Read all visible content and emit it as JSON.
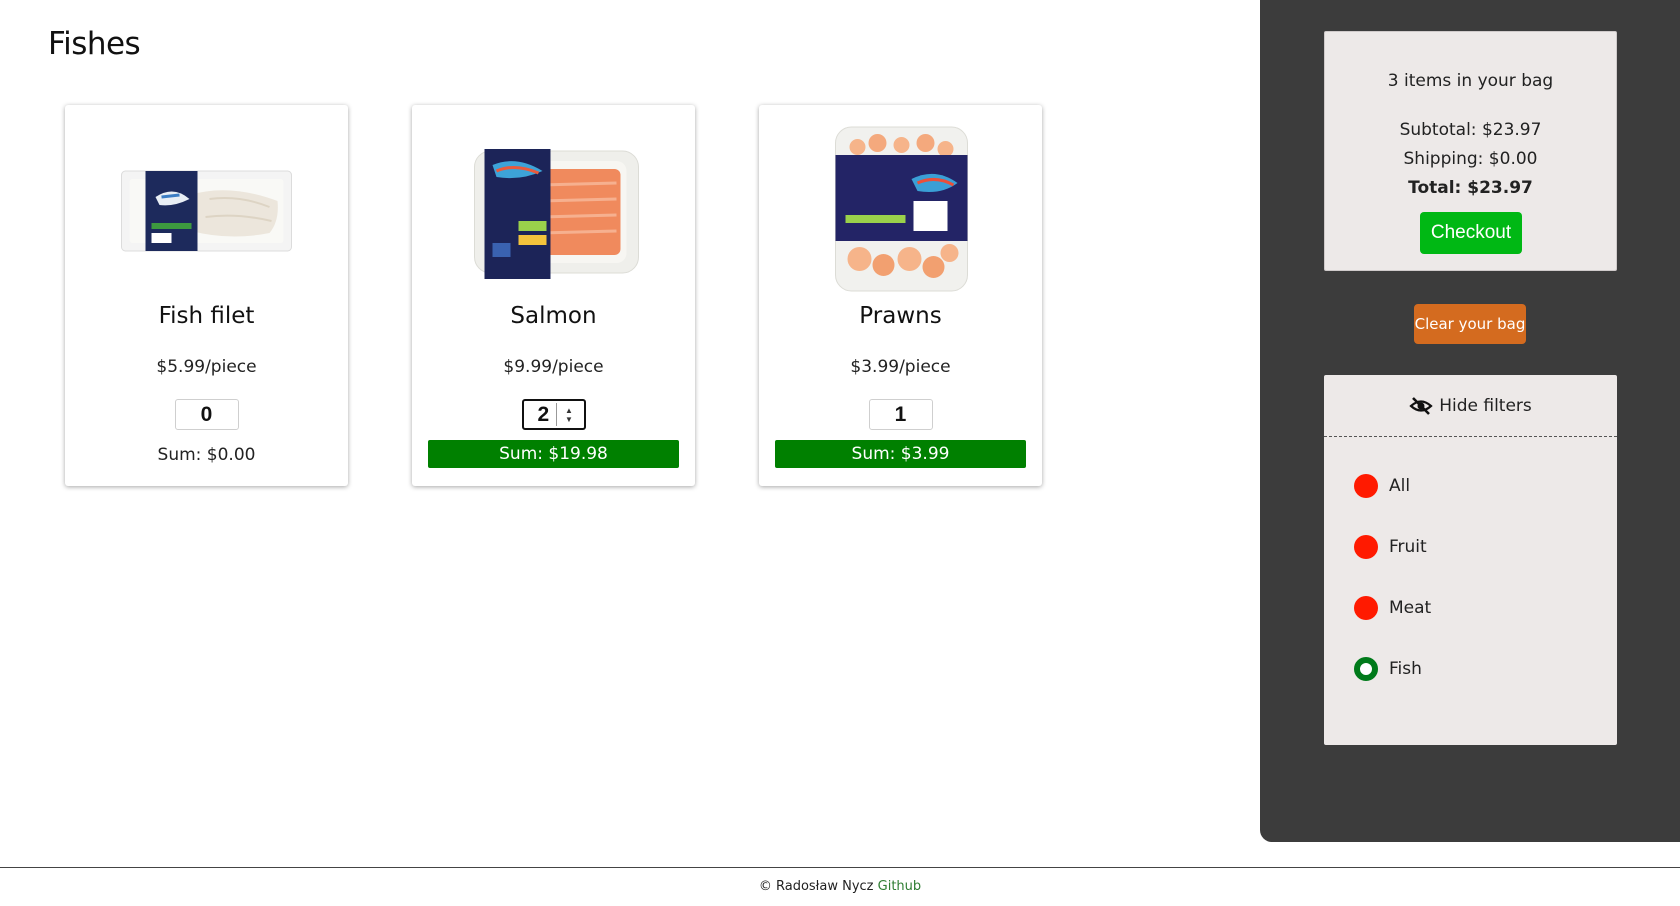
{
  "page": {
    "title": "Fishes"
  },
  "products": [
    {
      "name": "Fish filet",
      "price": "$5.99/piece",
      "quantity": "0",
      "sum": "Sum: $0.00",
      "image_icon": "fish-filet-package-icon"
    },
    {
      "name": "Salmon",
      "price": "$9.99/piece",
      "quantity": "2",
      "sum": "Sum: $19.98",
      "image_icon": "salmon-package-icon"
    },
    {
      "name": "Prawns",
      "price": "$3.99/piece",
      "quantity": "1",
      "sum": "Sum: $3.99",
      "image_icon": "prawns-package-icon"
    }
  ],
  "bag": {
    "count": "3 items in your bag",
    "subtotal": "Subtotal: $23.97",
    "shipping": "Shipping: $0.00",
    "total": "Total: $23.97",
    "checkout_label": "Checkout",
    "clear_label": "Clear your bag"
  },
  "filters": {
    "toggle_label": "Hide filters",
    "toggle_icon": "eye-slash-icon",
    "items": [
      {
        "label": "All",
        "selected": false
      },
      {
        "label": "Fruit",
        "selected": false
      },
      {
        "label": "Meat",
        "selected": false
      },
      {
        "label": "Fish",
        "selected": true
      }
    ]
  },
  "footer": {
    "copyright_symbol": "©",
    "author": "Radosław Nycz",
    "link_label": "Github"
  },
  "colors": {
    "sum_active": "#008000",
    "checkout": "#00b814",
    "clear": "#d46b1f",
    "sidebar": "#3c3c3c",
    "radio_unselected": "#ff1a00",
    "radio_selected": "#007a1a"
  }
}
